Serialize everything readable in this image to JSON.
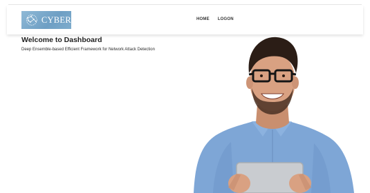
{
  "brand": {
    "logo_text": "CYBER",
    "logo_color": "#7eaccc"
  },
  "nav": {
    "items": [
      {
        "label": "HOME"
      },
      {
        "label": "LOGON"
      }
    ]
  },
  "main": {
    "title": "Welcome to Dashboard",
    "subtitle": "Deep Ensemble-based Efficient Framework for Network Attack Detection"
  },
  "hero": {
    "description": "smiling-man-holding-tablet",
    "shirt_color": "#7ea6d6"
  }
}
